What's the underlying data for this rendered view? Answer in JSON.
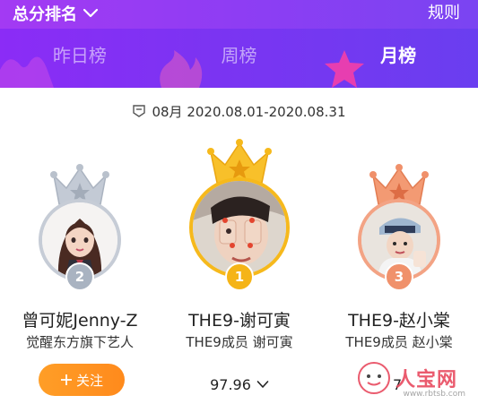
{
  "header": {
    "ranking_select_label": "总分排名",
    "rules_label": "规则",
    "tabs": [
      {
        "label": "昨日榜",
        "active": false
      },
      {
        "label": "周榜",
        "active": false
      },
      {
        "label": "月榜",
        "active": true
      }
    ]
  },
  "date_range": {
    "icon": "calendar-tag-icon",
    "text": "08月 2020.08.01-2020.08.31"
  },
  "podium": [
    {
      "rank": "2",
      "name": "曾可妮Jenny-Z",
      "subtitle": "觉醒东方旗下艺人",
      "crown_color": "#b8c0cc",
      "badge_color": "#a9b3c1",
      "follow_label": "关注"
    },
    {
      "rank": "1",
      "name": "THE9-谢可寅",
      "subtitle": "THE9成员 谢可寅",
      "crown_color": "#f6b91c",
      "badge_color": "#f5b417",
      "score": "97.96"
    },
    {
      "rank": "3",
      "name": "THE9-赵小棠",
      "subtitle": "THE9成员 赵小棠",
      "crown_color": "#f0906a",
      "badge_color": "#f0916b",
      "score": "7"
    }
  ],
  "watermark": {
    "text": "人宝网",
    "sub": "www.rbtsb.com"
  },
  "colors": {
    "header_gradient_start": "#8b2cf6",
    "header_gradient_end": "#6a3ef0",
    "follow_button": "#ff8f22"
  }
}
